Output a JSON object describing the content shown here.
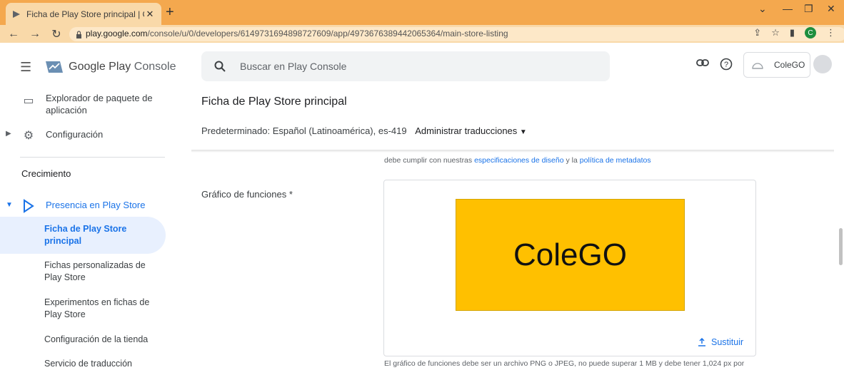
{
  "browser": {
    "tab_title": "Ficha de Play Store principal | Co",
    "url_host": "play.google.com",
    "url_path": "/console/u/0/developers/6149731694898727609/app/4973676389442065364/main-store-listing",
    "profile_initial": "C",
    "accent_color": "#f4a84e"
  },
  "header": {
    "brand_google": "Google Play",
    "brand_console": "Console",
    "search_placeholder": "Buscar en Play Console",
    "account_name": "ColeGO"
  },
  "sidebar": {
    "items": [
      {
        "label_line1": "Explorador de paquete de",
        "label_line2": "aplicación"
      },
      {
        "label": "Configuración"
      }
    ],
    "section_crecimiento": "Crecimiento",
    "presence": "Presencia en Play Store",
    "sub_items": [
      {
        "line1": "Ficha de Play Store",
        "line2": "principal"
      },
      {
        "line1": "Fichas personalizadas de",
        "line2": "Play Store"
      },
      {
        "line1": "Experimentos en fichas de",
        "line2": "Play Store"
      },
      {
        "line1": "Configuración de la tienda",
        "line2": ""
      },
      {
        "line1": "Servicio de traducción",
        "line2": ""
      }
    ]
  },
  "main": {
    "page_title": "Ficha de Play Store principal",
    "default_lang": "Predeterminado: Español (Latinoamérica), es-419",
    "manage_translations": "Administrar traducciones",
    "spec_prefix": "debe cumplir con nuestras",
    "spec_link1": "especificaciones de diseño",
    "spec_mid": "y la",
    "spec_link2": "política de metadatos",
    "feature_label": "Gráfico de funciones",
    "required_mark": "*",
    "feature_image_text": "ColeGO",
    "replace_label": "Sustituir",
    "help_text": "El gráfico de funciones debe ser un archivo PNG o JPEG, no puede superar 1 MB y debe tener 1,024 px por"
  }
}
